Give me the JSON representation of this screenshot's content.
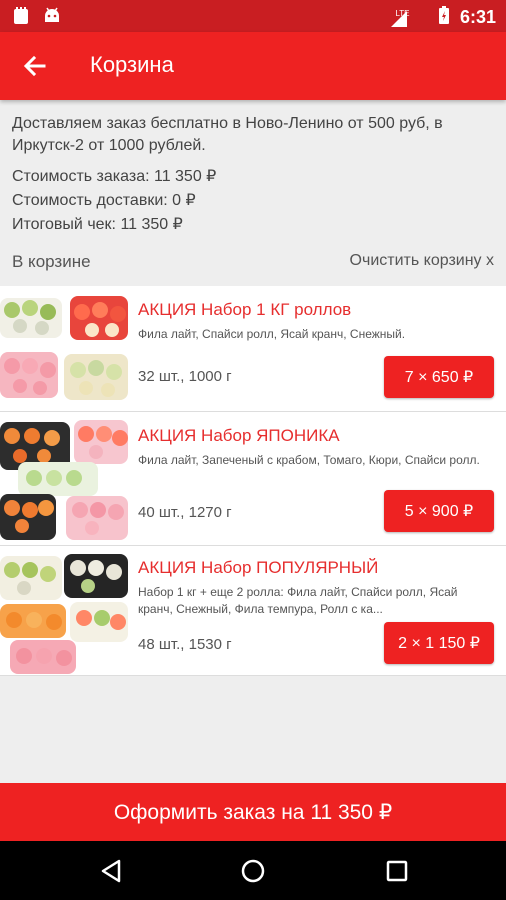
{
  "status_bar": {
    "time": "6:31",
    "network_label": "LTE"
  },
  "app_bar": {
    "title": "Корзина"
  },
  "info": {
    "delivery_note": "Доставляем заказ бесплатно в Ново-Ленино от 500 руб, в Иркутск-2 от 1000 рублей.",
    "order_cost": "Стоимость заказа: 11 350 ₽",
    "delivery_cost": "Стоимость доставки: 0 ₽",
    "total": "Итоговый чек: 11 350 ₽"
  },
  "cart": {
    "header": "В корзине",
    "clear_label": "Очистить корзину x",
    "items": [
      {
        "name": "АКЦИЯ Набор 1 КГ роллов",
        "description": "Фила лайт, Спайси ролл, Ясай кранч, Снежный.",
        "meta": "32 шт., 1000 г",
        "price": "7 × 650 ₽"
      },
      {
        "name": "АКЦИЯ Набор ЯПОНИКА",
        "description": "Фила лайт, Запеченый с крабом, Томаго, Кюри, Спайси ролл.",
        "meta": "40 шт., 1270 г",
        "price": "5 × 900 ₽"
      },
      {
        "name": "АКЦИЯ Набор ПОПУЛЯРНЫЙ",
        "description": "Набор 1 кг + еще 2 ролла: Фила лайт, Спайси ролл, Ясай кранч, Снежный, Фила темпура, Ролл с ка...",
        "meta": "48 шт., 1530 г",
        "price": "2 × 1 150 ₽"
      }
    ]
  },
  "checkout": {
    "label": "Оформить заказ на 11 350 ₽"
  },
  "colors": {
    "primary": "#ee2222",
    "status_bar": "#c91e22",
    "title_red": "#e62e2e",
    "background": "#eeeeee"
  },
  "icons": [
    "notification-icon",
    "android-icon",
    "signal-icon",
    "battery-icon",
    "back-arrow-icon",
    "nav-back-icon",
    "nav-home-icon",
    "nav-recents-icon"
  ]
}
